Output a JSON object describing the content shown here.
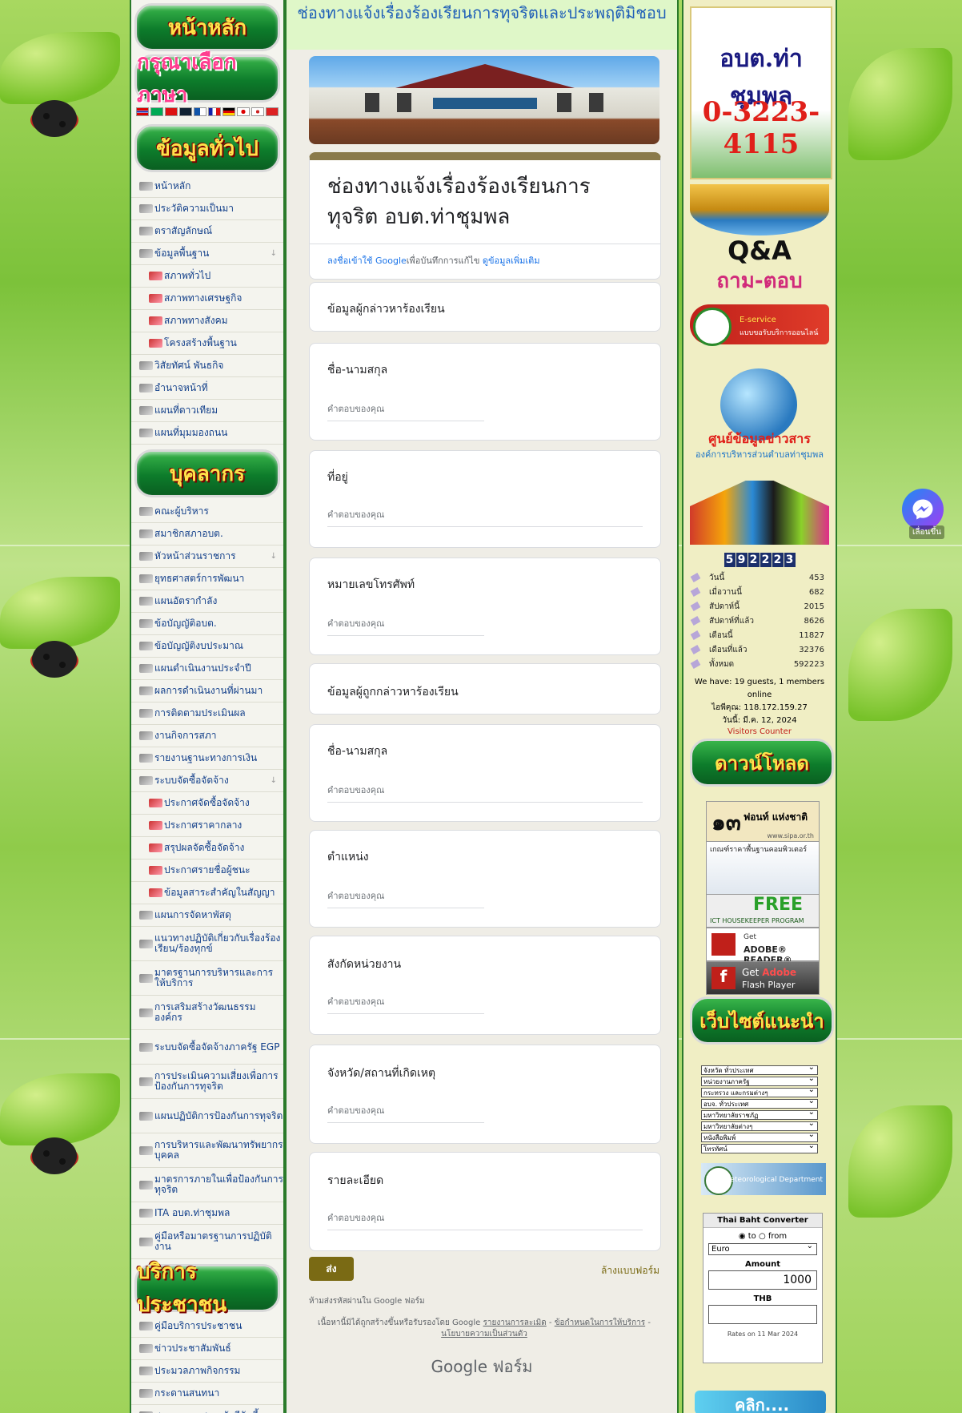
{
  "page_title": "ช่องทางแจ้งเรื่องร้องเรียนการทุจริตและประพฤติมิชอบ",
  "left_menu": {
    "headers": {
      "home": "หน้าหลัก",
      "language": "กรุณาเลือกภาษา",
      "general": "ข้อมูลทั่วไป",
      "personnel": "บุคลากร",
      "service": "บริการประชาชน"
    },
    "general_items": [
      {
        "label": "หน้าหลัก",
        "sub": false,
        "arrow": false
      },
      {
        "label": "ประวัติความเป็นมา",
        "sub": false,
        "arrow": false
      },
      {
        "label": "ตราสัญลักษณ์",
        "sub": false,
        "arrow": false
      },
      {
        "label": "ข้อมูลพื้นฐาน",
        "sub": false,
        "arrow": true
      },
      {
        "label": "สภาพทั่วไป",
        "sub": true,
        "arrow": false
      },
      {
        "label": "สภาพทางเศรษฐกิจ",
        "sub": true,
        "arrow": false
      },
      {
        "label": "สภาพทางสังคม",
        "sub": true,
        "arrow": false
      },
      {
        "label": "โครงสร้างพื้นฐาน",
        "sub": true,
        "arrow": false
      },
      {
        "label": "วิสัยทัศน์ พันธกิจ",
        "sub": false,
        "arrow": false
      },
      {
        "label": "อำนาจหน้าที่",
        "sub": false,
        "arrow": false
      },
      {
        "label": "แผนที่ดาวเทียม",
        "sub": false,
        "arrow": false
      },
      {
        "label": "แผนที่มุมมองถนน",
        "sub": false,
        "arrow": false
      }
    ],
    "personnel_items": [
      {
        "label": "คณะผู้บริหาร",
        "sub": false,
        "arrow": false,
        "tall": false
      },
      {
        "label": "สมาชิกสภาอบต.",
        "sub": false,
        "arrow": false,
        "tall": false
      },
      {
        "label": "หัวหน้าส่วนราชการ",
        "sub": false,
        "arrow": true,
        "tall": false
      },
      {
        "label": "ยุทธศาสตร์การพัฒนา",
        "sub": false,
        "arrow": false,
        "tall": false
      },
      {
        "label": "แผนอัตรากำลัง",
        "sub": false,
        "arrow": false,
        "tall": false
      },
      {
        "label": "ข้อบัญญัติอบต.",
        "sub": false,
        "arrow": false,
        "tall": false
      },
      {
        "label": "ข้อบัญญัติงบประมาณ",
        "sub": false,
        "arrow": false,
        "tall": false
      },
      {
        "label": "แผนดำเนินงานประจำปี",
        "sub": false,
        "arrow": false,
        "tall": false
      },
      {
        "label": "ผลการดำเนินงานที่ผ่านมา",
        "sub": false,
        "arrow": false,
        "tall": false
      },
      {
        "label": "การติดตามประเมินผล",
        "sub": false,
        "arrow": false,
        "tall": false
      },
      {
        "label": "งานกิจการสภา",
        "sub": false,
        "arrow": false,
        "tall": false
      },
      {
        "label": "รายงานฐานะทางการเงิน",
        "sub": false,
        "arrow": false,
        "tall": false
      },
      {
        "label": "ระบบจัดซื้อจัดจ้าง",
        "sub": false,
        "arrow": true,
        "tall": false
      },
      {
        "label": "ประกาศจัดซื้อจัดจ้าง",
        "sub": true,
        "arrow": false,
        "tall": false
      },
      {
        "label": "ประกาศราคากลาง",
        "sub": true,
        "arrow": false,
        "tall": false
      },
      {
        "label": "สรุปผลจัดซื้อจัดจ้าง",
        "sub": true,
        "arrow": false,
        "tall": false
      },
      {
        "label": "ประกาศรายชื่อผู้ชนะ",
        "sub": true,
        "arrow": false,
        "tall": false
      },
      {
        "label": "ข้อมูลสาระสำคัญในสัญญา",
        "sub": true,
        "arrow": false,
        "tall": false
      },
      {
        "label": "แผนการจัดหาพัสดุ",
        "sub": false,
        "arrow": false,
        "tall": false
      },
      {
        "label": "แนวทางปฏิบัติเกี่ยวกับเรื่องร้องเรียน/ร้องทุกข์",
        "sub": false,
        "arrow": false,
        "tall": true
      },
      {
        "label": "มาตรฐานการบริหารและการให้บริการ",
        "sub": false,
        "arrow": false,
        "tall": true
      },
      {
        "label": "การเสริมสร้างวัฒนธรรมองค์กร",
        "sub": false,
        "arrow": false,
        "tall": true
      },
      {
        "label": "ระบบจัดซื้อจัดจ้างภาครัฐ EGP",
        "sub": false,
        "arrow": false,
        "tall": true
      },
      {
        "label": "การประเมินความเสี่ยงเพื่อการป้องกันการทุจริต",
        "sub": false,
        "arrow": false,
        "tall": true
      },
      {
        "label": "แผนปฏิบัติการป้องกันการทุจริต",
        "sub": false,
        "arrow": false,
        "tall": true
      },
      {
        "label": "การบริหารและพัฒนาทรัพยากรบุคคล",
        "sub": false,
        "arrow": false,
        "tall": true
      },
      {
        "label": "มาตรการภายในเพื่อป้องกันการทุจริต",
        "sub": false,
        "arrow": false,
        "tall": true
      },
      {
        "label": "ITA อบต.ท่าชุมพล",
        "sub": false,
        "arrow": false,
        "tall": false
      },
      {
        "label": "คู่มือหรือมาตรฐานการปฏิบัติงาน",
        "sub": false,
        "arrow": false,
        "tall": true
      }
    ],
    "service_items": [
      {
        "label": "คู่มือบริการประชาชน",
        "sub": false,
        "arrow": false
      },
      {
        "label": "ข่าวประชาสัมพันธ์",
        "sub": false,
        "arrow": false
      },
      {
        "label": "ประมวลภาพกิจกรรม",
        "sub": false,
        "arrow": false
      },
      {
        "label": "กระดานสนทนา",
        "sub": false,
        "arrow": false
      },
      {
        "label": "สภาพอากาศรายวันรีวันนี้",
        "sub": false,
        "arrow": false
      }
    ]
  },
  "form": {
    "title": "ช่องทางแจ้งเรื่องร้องเรียนการทุจริต อบต.ท่าชุมพล",
    "signin_link": "ลงชื่อเข้าใช้ Google",
    "signin_rest": "เพื่อบันทึกการแก้ไข",
    "more_info": "ดูข้อมูลเพิ่มเติม",
    "section1": "ข้อมูลผู้กล่าวหาร้องเรียน",
    "section2": "ข้อมูลผู้ถูกกล่าวหาร้องเรียน",
    "placeholder": "คำตอบของคุณ",
    "questions": {
      "q_name1": "ชื่อ-นามสกุล",
      "q_address": "ที่อยู่",
      "q_phone": "หมายเลขโทรศัพท์",
      "q_name2": "ชื่อ-นามสกุล",
      "q_position": "ตำแหน่ง",
      "q_agency": "สังกัดหน่วยงาน",
      "q_province": "จังหวัด/สถานที่เกิดเหตุ",
      "q_detail": "รายละเอียด"
    },
    "submit": "ส่ง",
    "clear": "ล้างแบบฟอร์ม",
    "no_password": "ห้ามส่งรหัสผ่านใน Google ฟอร์ม",
    "disclaimer_a": "เนื้อหานี้มิได้ถูกสร้างขึ้นหรือรับรองโดย Google",
    "report": "รายงานการละเมิด",
    "terms": "ข้อกำหนดในการให้บริการ",
    "privacy": "นโยบายความเป็นส่วนตัว",
    "brand": "Google ฟอร์ม"
  },
  "right": {
    "phone_name": "อบต.ท่าชุมพล",
    "phone_number": "0-3223-4115",
    "qa_title": "Q&A",
    "qa_sub": "ถาม-ตอบ",
    "eservice_a": "E-service",
    "eservice_b": "แบบขอรับบริการออนไลน์",
    "info_title": "ศูนย์ข้อมูลข่าวสาร",
    "info_sub": "องค์การบริหารส่วนตำบลท่าชุมพล",
    "counter_digits": [
      "5",
      "9",
      "2",
      "2",
      "2",
      "3"
    ],
    "stats": [
      {
        "label": "วันนี้",
        "value": "453"
      },
      {
        "label": "เมื่อวานนี้",
        "value": "682"
      },
      {
        "label": "สัปดาห์นี้",
        "value": "2015"
      },
      {
        "label": "สัปดาห์ที่แล้ว",
        "value": "8626"
      },
      {
        "label": "เดือนนี้",
        "value": "11827"
      },
      {
        "label": "เดือนที่แล้ว",
        "value": "32376"
      },
      {
        "label": "ทั้งหมด",
        "value": "592223"
      }
    ],
    "we_have": "We have: 19 guests, 1 members online",
    "your_ip": "ไอพีคุณ: 118.172.159.27",
    "today": "วันนี้: มี.ค. 12, 2024",
    "visitors_counter": "Visitors Counter",
    "download_header": "ดาวน์โหลด",
    "font_big": "๑๓",
    "font_label": "ฟอนท์ แห่งชาติ",
    "font_url": "www.sipa.or.th",
    "computer_text": "เกณฑ์ราคาพื้นฐานคอมพิวเตอร์",
    "free_text": "FREE",
    "free_sub": "ICT HOUSEKEEPER PROGRAM",
    "adobe_get": "Get",
    "adobe_reader": "ADOBE® READER®",
    "flash_get": "Get",
    "flash_adobe": "Adobe",
    "flash_player": "Flash Player",
    "websites_header": "เว็บไซต์แนะนำ",
    "selects": [
      "จังหวัด ทั่วประเทศ",
      "หน่วยงานภาครัฐ",
      "กระทรวง และกรมต่างๆ",
      "อบจ. ทั่วประเทศ",
      "มหาวิทยาลัยราชภัฏ",
      "มหาวิทยาลัยต่างๆ",
      "หนังสือพิมพ์",
      "โทรทัศน์"
    ],
    "tmd": "Thai Meteorological Department",
    "converter": {
      "title": "Thai Baht Converter",
      "to": "to",
      "from": "from",
      "currency": "Euro",
      "amount_label": "Amount",
      "amount": "1000",
      "thb_label": "THB",
      "rates": "Rates on 11 Mar 2024"
    },
    "click_text": "คลิก...."
  },
  "scroll_up": "เลื่อนขึ้น"
}
